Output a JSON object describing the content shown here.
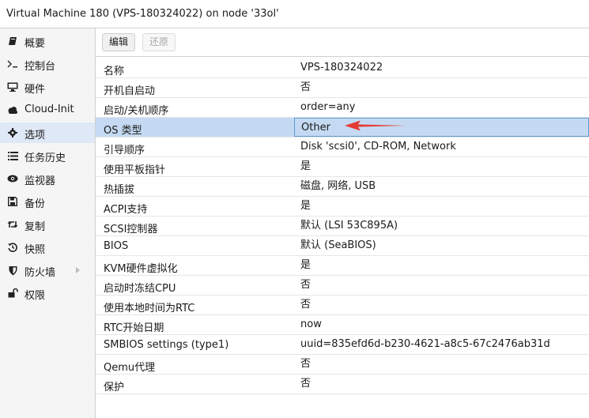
{
  "window": {
    "title": "Virtual Machine 180 (VPS-180324022) on node '33ol'"
  },
  "sidebar": {
    "items": [
      {
        "label": "概要",
        "icon": "book-icon"
      },
      {
        "label": "控制台",
        "icon": "terminal-icon"
      },
      {
        "label": "硬件",
        "icon": "monitor-icon"
      },
      {
        "label": "Cloud-Init",
        "icon": "cloud-icon"
      },
      {
        "label": "选项",
        "icon": "gear-icon",
        "selected": true
      },
      {
        "label": "任务历史",
        "icon": "list-icon"
      },
      {
        "label": "监视器",
        "icon": "eye-icon"
      },
      {
        "label": "备份",
        "icon": "floppy-icon"
      },
      {
        "label": "复制",
        "icon": "retweet-icon"
      },
      {
        "label": "快照",
        "icon": "history-icon"
      },
      {
        "label": "防火墙",
        "icon": "shield-icon",
        "expandable": true
      },
      {
        "label": "权限",
        "icon": "unlock-icon"
      }
    ]
  },
  "toolbar": {
    "edit_label": "编辑",
    "revert_label": "还原"
  },
  "options": {
    "rows": [
      {
        "key": "名称",
        "value": "VPS-180324022"
      },
      {
        "key": "开机自启动",
        "value": "否"
      },
      {
        "key": "启动/关机顺序",
        "value": "order=any"
      },
      {
        "key": "OS 类型",
        "value": "Other",
        "selected": true
      },
      {
        "key": "引导顺序",
        "value": "Disk 'scsi0', CD-ROM, Network"
      },
      {
        "key": "使用平板指针",
        "value": "是"
      },
      {
        "key": "热插拔",
        "value": "磁盘, 网络, USB"
      },
      {
        "key": "ACPI支持",
        "value": "是"
      },
      {
        "key": "SCSI控制器",
        "value": "默认 (LSI 53C895A)"
      },
      {
        "key": "BIOS",
        "value": "默认 (SeaBIOS)"
      },
      {
        "key": "KVM硬件虚拟化",
        "value": "是"
      },
      {
        "key": "启动时冻结CPU",
        "value": "否"
      },
      {
        "key": "使用本地时间为RTC",
        "value": "否"
      },
      {
        "key": "RTC开始日期",
        "value": "now"
      },
      {
        "key": "SMBIOS settings (type1)",
        "value": "uuid=835efd6d-b230-4621-a8c5-67c2476ab31d"
      },
      {
        "key": "Qemu代理",
        "value": "否"
      },
      {
        "key": "保护",
        "value": "否"
      }
    ]
  },
  "annotation": {
    "arrow_color": "#e53935"
  },
  "colors": {
    "selected_row": "#c5daf2",
    "selected_nav": "#dfe8f6"
  }
}
